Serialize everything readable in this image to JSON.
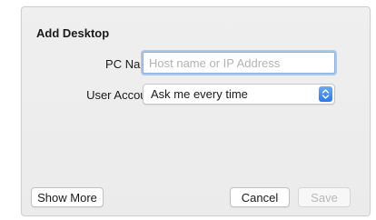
{
  "dialog": {
    "title": "Add Desktop",
    "pc_name": {
      "label": "PC Name:",
      "value": "",
      "placeholder": "Host name or IP Address"
    },
    "user_account": {
      "label": "User Account:",
      "selected": "Ask me every time",
      "icon": "select-arrows-icon"
    },
    "buttons": {
      "show_more": "Show More",
      "cancel": "Cancel",
      "save": "Save"
    }
  },
  "colors": {
    "focus_ring": "#a9c8ed",
    "select_accent": "#2a78ef",
    "disabled_text": "#b8b8b8"
  }
}
